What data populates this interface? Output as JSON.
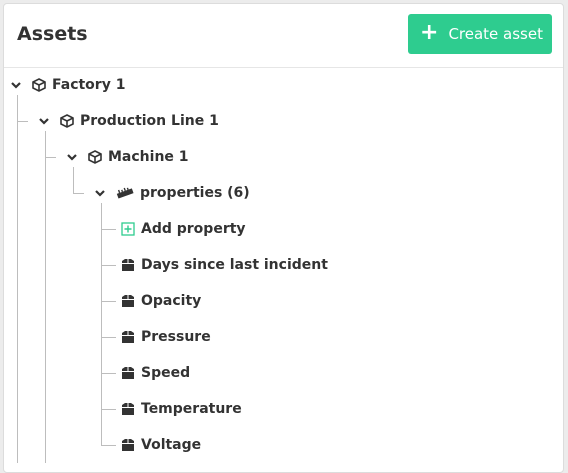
{
  "header": {
    "title": "Assets",
    "create_label": "Create asset",
    "accent": "#2ecc8f"
  },
  "tree": {
    "factory": {
      "label": "Factory 1",
      "icon": "cube-icon"
    },
    "line": {
      "label": "Production Line 1",
      "icon": "cube-icon"
    },
    "machine": {
      "label": "Machine 1",
      "icon": "cube-icon"
    },
    "properties": {
      "label": "properties (6)",
      "icon": "ruler-icon"
    },
    "add_property": {
      "label": "Add property",
      "icon": "plus-square-icon",
      "color": "#2ecc8f"
    },
    "items": [
      {
        "label": "Days since last incident",
        "icon": "box-icon"
      },
      {
        "label": "Opacity",
        "icon": "box-icon"
      },
      {
        "label": "Pressure",
        "icon": "box-icon"
      },
      {
        "label": "Speed",
        "icon": "box-icon"
      },
      {
        "label": "Temperature",
        "icon": "box-icon"
      },
      {
        "label": "Voltage",
        "icon": "box-icon"
      }
    ]
  }
}
